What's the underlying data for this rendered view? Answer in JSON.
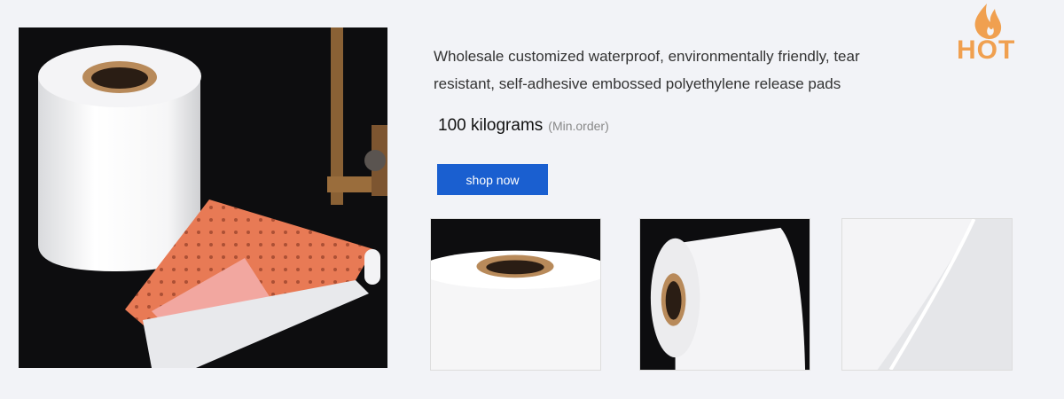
{
  "product": {
    "title": "Wholesale customized waterproof, environmentally friendly, tear resistant, self-adhesive embossed polyethylene release pads",
    "moq_value": "100 kilograms",
    "moq_unit": "(Min.order)",
    "shop_label": "shop now"
  },
  "badge": {
    "text": "HOT",
    "icon": "flame-icon",
    "color": "#f0a050"
  },
  "colors": {
    "accent": "#1a5fd0",
    "background": "#f2f3f7"
  }
}
